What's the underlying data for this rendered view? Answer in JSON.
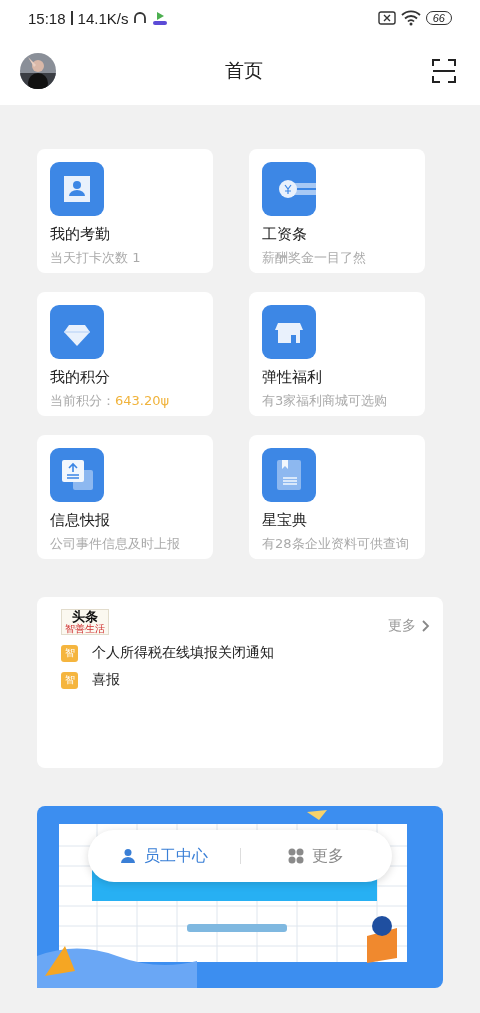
{
  "status_bar": {
    "time": "15:18",
    "network_speed": "14.1K/s",
    "battery": "66"
  },
  "header": {
    "title": "首页"
  },
  "tiles": [
    {
      "kind": "attendance",
      "title": "我的考勤",
      "subtitle": "当天打卡次数 1"
    },
    {
      "kind": "salary",
      "title": "工资条",
      "subtitle": "薪酬奖金一目了然"
    },
    {
      "kind": "points",
      "title": "我的积分",
      "subtitle": "当前积分：",
      "value": "643.20ψ"
    },
    {
      "kind": "store",
      "title": "弹性福利",
      "subtitle": "有3家福利商城可选购"
    },
    {
      "kind": "upload",
      "title": "信息快报",
      "subtitle": "公司事件信息及时上报"
    },
    {
      "kind": "book",
      "title": "星宝典",
      "subtitle": "有28条企业资料可供查询"
    }
  ],
  "news": {
    "logo_title": "头条",
    "logo_subtitle": "智善生活",
    "more": "更多",
    "items": [
      {
        "badge": "智",
        "text": "个人所得税在线填报关闭通知"
      },
      {
        "badge": "智",
        "text": "喜报"
      }
    ]
  },
  "bottom_nav": [
    {
      "kind": "staff",
      "label": "员工中心",
      "selected": true
    },
    {
      "kind": "more",
      "label": "更多",
      "selected": false
    }
  ]
}
